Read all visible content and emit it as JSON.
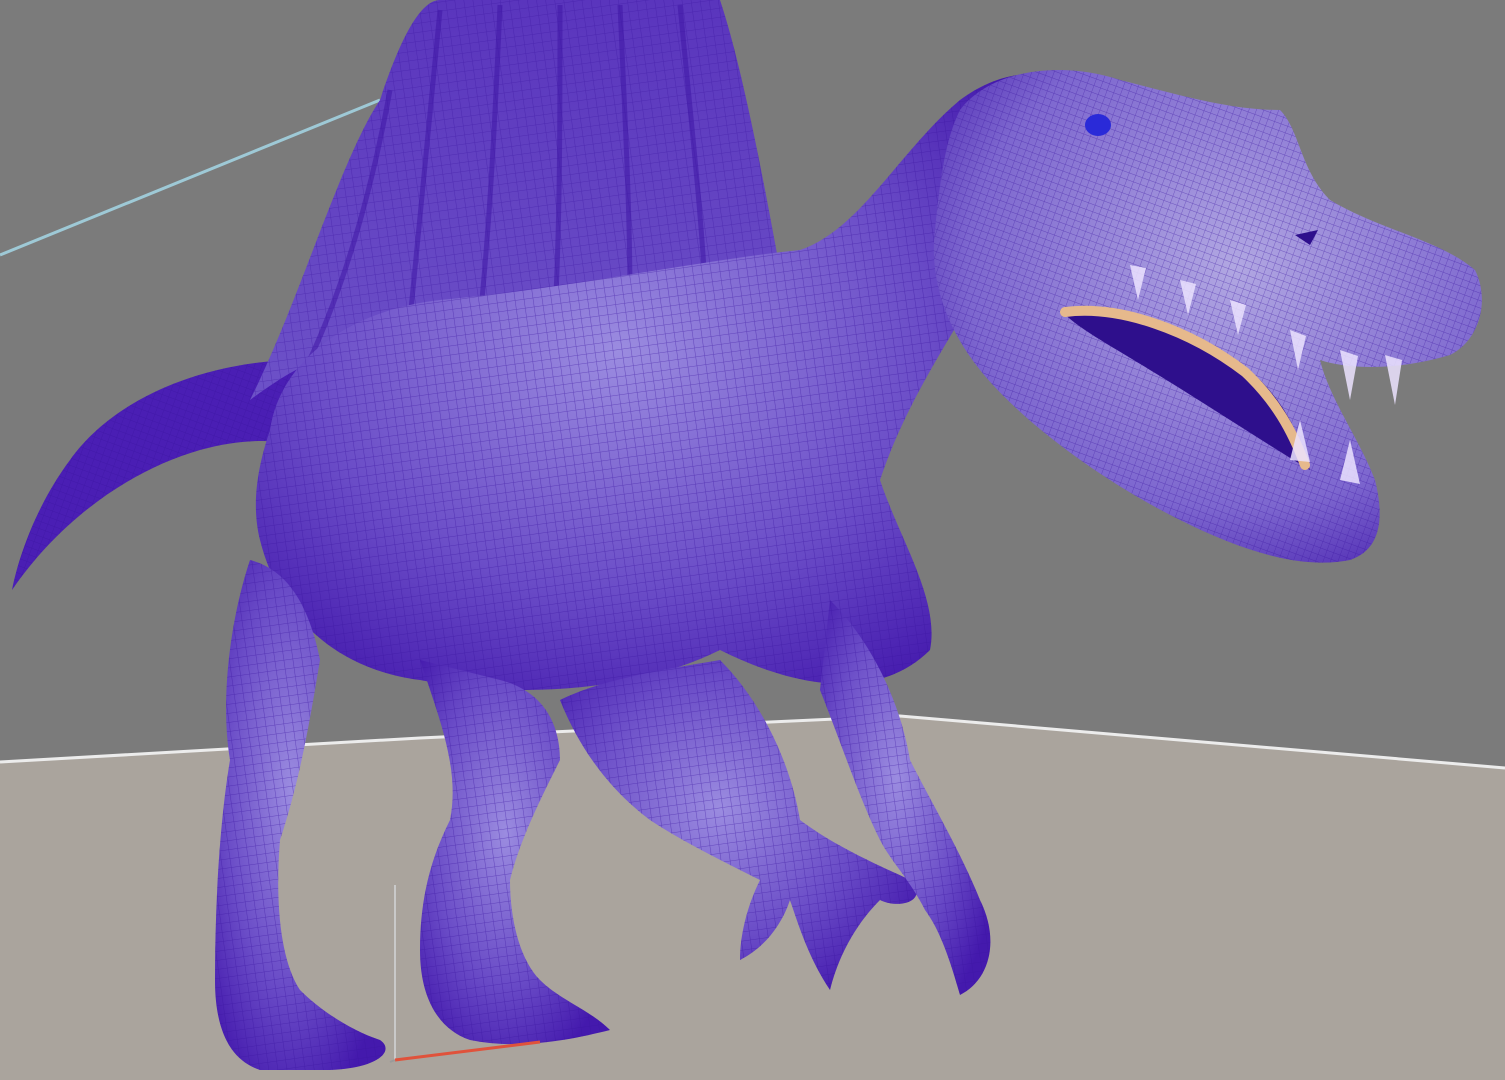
{
  "viewport": {
    "background_color": "#7b7b7b",
    "ground_color": "#aaa49d",
    "ground_edge_color": "#ececec",
    "wire_color": "#4a1eb4",
    "mesh_shade_light": "#8f7fd6",
    "mesh_shade_dark": "#4b23b0",
    "eye_color": "#2a2ad8",
    "teeth_color": "#e6b98c",
    "guide_line_color": "#9ec9d6"
  },
  "model": {
    "icon": "wireframe-mesh-icon",
    "selected": true
  },
  "axis_gizmo": {
    "icon": "axis-gizmo-icon",
    "x_axis_color": "#e0523b",
    "y_axis_color": "#9a9a9a",
    "z_axis_color": "#c9c9c9"
  }
}
